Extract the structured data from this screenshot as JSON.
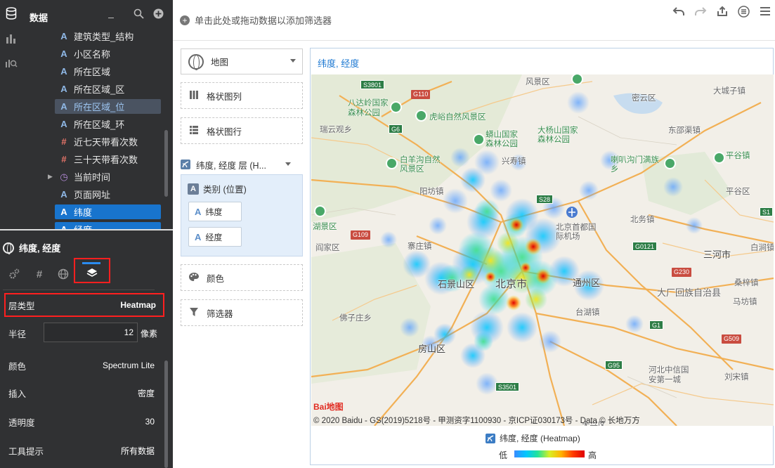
{
  "data_panel": {
    "title": "数据",
    "fields": [
      {
        "type": "A",
        "label": "建筑类型_结构"
      },
      {
        "type": "A",
        "label": "小区名称"
      },
      {
        "type": "A",
        "label": "所在区域"
      },
      {
        "type": "A",
        "label": "所在区域_区"
      },
      {
        "type": "A",
        "label": "所在区域_位"
      },
      {
        "type": "A",
        "label": "所在区域_环"
      },
      {
        "type": "#",
        "label": "近七天带看次数"
      },
      {
        "type": "#",
        "label": "三十天带看次数"
      },
      {
        "type": "◷",
        "label": "当前时间"
      },
      {
        "type": "A",
        "label": "页面网址"
      },
      {
        "type": "A",
        "label": "纬度"
      },
      {
        "type": "A",
        "label": "经度"
      }
    ]
  },
  "properties": {
    "title": "纬度, 经度",
    "layer_type_label": "层类型",
    "layer_type_value": "Heatmap",
    "radius_label": "半径",
    "radius_value": "12",
    "radius_unit": "像素",
    "color_label": "颜色",
    "color_value": "Spectrum Lite",
    "interp_label": "插入",
    "interp_value": "密度",
    "opacity_label": "透明度",
    "opacity_value": "30",
    "tooltip_label": "工具提示",
    "tooltip_value": "所有数据"
  },
  "topbar": {
    "filter_hint": "单击此处或拖动数据以添加筛选器",
    "icons": [
      "undo-icon",
      "redo-icon",
      "share-icon",
      "list-icon",
      "menu-icon"
    ]
  },
  "shelves": {
    "chart_type": "地图",
    "columns": "格状图列",
    "rows": "格状图行",
    "layer": "纬度, 经度 层 (H...",
    "category": "类别 (位置)",
    "pill_lat": "纬度",
    "pill_lng": "经度",
    "color": "颜色",
    "filter": "筛选器"
  },
  "map_card": {
    "title": "纬度, 经度",
    "places": [
      "风景区",
      "密云区",
      "大城子镇",
      "八达岭国家森林公园",
      "虎峪自然风景区",
      "东邵渠镇",
      "瑞云观乡",
      "蟒山国家森林公园",
      "大杨山国家森林公园",
      "白羊沟自然风景区",
      "兴寿镇",
      "喇叭沟门满族乡",
      "平谷镇",
      "阳坊镇",
      "平谷区",
      "北务镇",
      "湖景区",
      "北京首都国际机场",
      "阎家区",
      "寨庄镇",
      "三河市",
      "白涧镇",
      "石景山区",
      "北京市",
      "通州区",
      "大厂回族自治县",
      "桑梓镇",
      "台湖镇",
      "佛子庄乡",
      "马坊镇",
      "房山区",
      "河北中信国安第一城",
      "刘宋镇",
      "大兴区"
    ],
    "shields": [
      "S3801",
      "G110",
      "G6",
      "S28",
      "G109",
      "G0121",
      "G230",
      "G1",
      "G95",
      "S3501",
      "G509",
      "S1"
    ],
    "logo_text": "Bai地图",
    "copyright": "© 2020 Baidu - GS(2019)5218号 - 甲测资字1100930 - 京ICP证030173号 - Data © 长地万方",
    "legend_title": "纬度, 经度 (Heatmap)",
    "legend_low": "低",
    "legend_high": "高"
  }
}
